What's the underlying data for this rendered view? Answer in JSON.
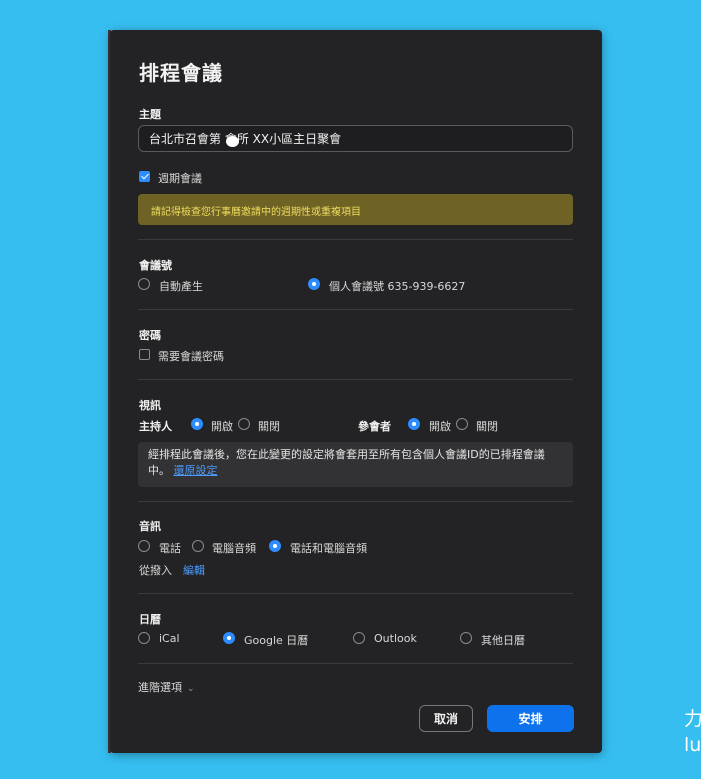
{
  "dialog": {
    "title": "排程會議",
    "topic": {
      "label": "主題",
      "value": "台北市召會第 會所 XX小區主日聚會"
    },
    "recurring": {
      "label": "週期會議",
      "checked": true
    },
    "warning": "請記得檢查您行事曆邀請中的週期性或重複項目",
    "meeting_id": {
      "label": "會議號",
      "options": [
        {
          "label": "自動產生",
          "selected": false
        },
        {
          "label": "個人會議號 635-939-6627",
          "selected": true
        }
      ]
    },
    "password": {
      "label": "密碼",
      "require_label": "需要會議密碼",
      "checked": false
    },
    "video": {
      "label": "視訊",
      "host_label": "主持人",
      "participant_label": "參會者",
      "on_label": "開啟",
      "off_label": "關閉",
      "host_on": true,
      "participant_on": true,
      "note": "經排程此會議後，您在此變更的設定將會套用至所有包含個人會議ID的已排程會議中。",
      "note_link": "還原設定"
    },
    "audio": {
      "label": "音訊",
      "options": [
        {
          "label": "電話",
          "selected": false
        },
        {
          "label": "電腦音頻",
          "selected": false
        },
        {
          "label": "電話和電腦音頻",
          "selected": true
        }
      ],
      "dial_in_label": "從撥入",
      "edit_label": "編輯"
    },
    "calendar": {
      "label": "日曆",
      "options": [
        {
          "label": "iCal",
          "selected": false
        },
        {
          "label": "Google 日曆",
          "selected": true
        },
        {
          "label": "Outlook",
          "selected": false
        },
        {
          "label": "其他日曆",
          "selected": false
        }
      ]
    },
    "advanced_label": "進階選項",
    "cancel_label": "取消",
    "schedule_label": "安排"
  },
  "corner_text": "力\nlu",
  "colors": {
    "background": "#36BEF0",
    "dialog": "#232325",
    "accent": "#2D8CFF",
    "warning_bg": "#6E6225",
    "warning_text": "#F0DE60"
  }
}
